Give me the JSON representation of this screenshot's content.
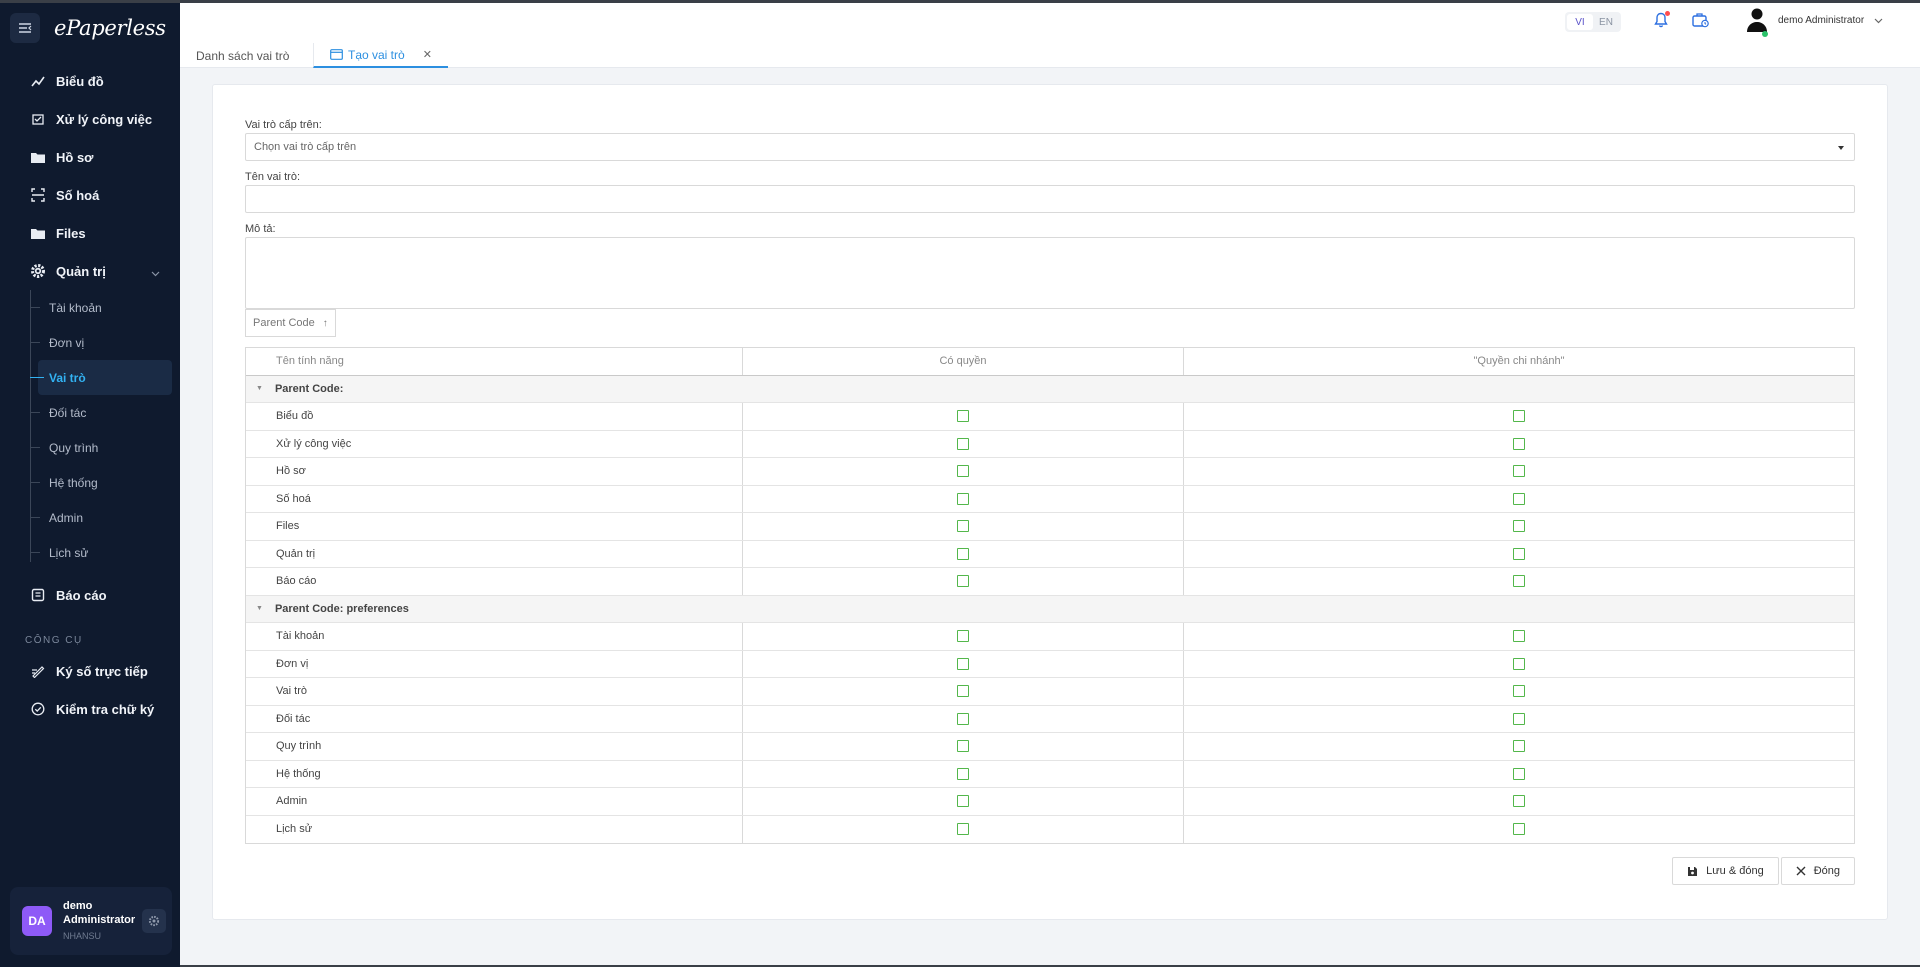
{
  "app": {
    "logo": "ePaperless"
  },
  "sidebar": {
    "items": [
      {
        "label": "Biểu đồ",
        "icon": "chart-line-icon"
      },
      {
        "label": "Xử lý công việc",
        "icon": "task-icon"
      },
      {
        "label": "Hồ sơ",
        "icon": "folder-icon"
      },
      {
        "label": "Số hoá",
        "icon": "scan-icon"
      },
      {
        "label": "Files",
        "icon": "folder-icon"
      },
      {
        "label": "Quản trị",
        "icon": "gear-icon"
      }
    ],
    "subitems": [
      "Tài khoản",
      "Đơn vị",
      "Vai trò",
      "Đối tác",
      "Quy trình",
      "Hệ thống",
      "Admin",
      "Lịch sử"
    ],
    "report": "Báo cáo",
    "tools_label": "CÔNG CỤ",
    "tools": [
      "Ký số trực tiếp",
      "Kiểm tra chữ ký"
    ],
    "user": {
      "initials": "DA",
      "name": "demo Administrator",
      "role": "NHANSU"
    }
  },
  "topbar": {
    "lang_vi": "VI",
    "lang_en": "EN",
    "user_name": "demo Administrator"
  },
  "tabs": {
    "list": "Danh sách vai trò",
    "create": "Tạo vai trò"
  },
  "form": {
    "parent_role_label": "Vai trò cấp trên:",
    "parent_role_placeholder": "Chọn vai trò cấp trên",
    "role_name_label": "Tên vai trò:",
    "description_label": "Mô tả:",
    "group_chip": "Parent Code",
    "columns": [
      "Tên tính năng",
      "Có quyền",
      "\"Quyền chi nhánh\""
    ],
    "groups": [
      {
        "label": "Parent Code:",
        "rows": [
          "Biểu đồ",
          "Xử lý công việc",
          "Hồ sơ",
          "Số hoá",
          "Files",
          "Quản trị",
          "Báo cáo"
        ]
      },
      {
        "label": "Parent Code: preferences",
        "rows": [
          "Tài khoản",
          "Đơn vị",
          "Vai trò",
          "Đối tác",
          "Quy trình",
          "Hệ thống",
          "Admin",
          "Lịch sử"
        ]
      }
    ],
    "save_close": "Lưu & đóng",
    "close": "Đóng"
  },
  "colors": {
    "accent": "#2c8fe0",
    "sidebar_bg": "#0f1a2e",
    "active": "#32b2f2",
    "checkbox": "#53b74b"
  }
}
